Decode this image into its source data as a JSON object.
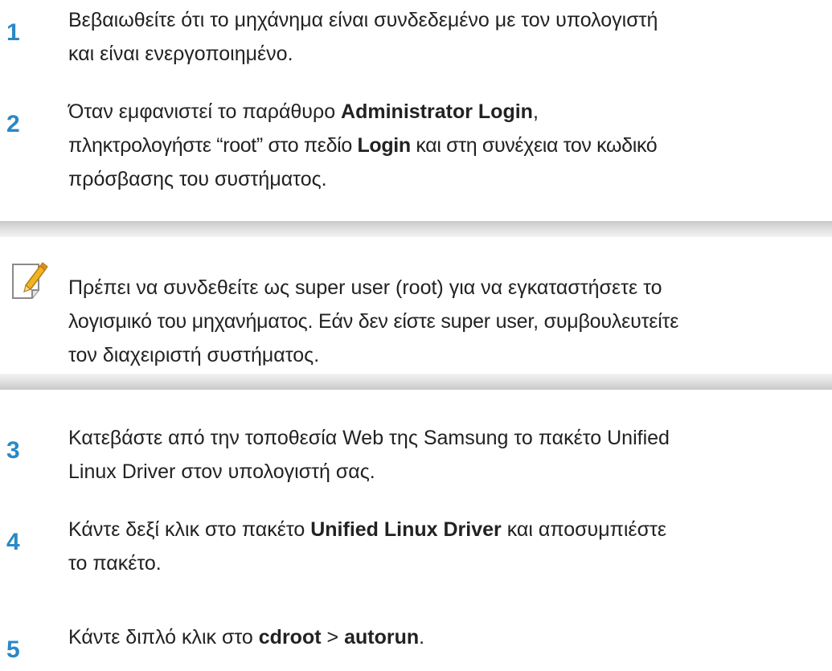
{
  "steps": [
    {
      "number": "1",
      "lines": [
        [
          {
            "t": "Βεβαιωθείτε ότι το μηχάνημα είναι συνδεδεμένο με τον υπολογιστή",
            "b": false
          }
        ],
        [
          {
            "t": "και είναι ενεργοποιημένο.",
            "b": false
          }
        ]
      ]
    },
    {
      "number": "2",
      "lines": [
        [
          {
            "t": "Όταν εμφανιστεί το παράθυρο ",
            "b": false
          },
          {
            "t": "Administrator Login",
            "b": true
          },
          {
            "t": ",",
            "b": false
          }
        ],
        [
          {
            "t": "πληκτρολογήστε “root” στο πεδίο ",
            "b": false
          },
          {
            "t": "Login",
            "b": true
          },
          {
            "t": " και στη συνέχεια τον κωδικό",
            "b": false
          }
        ],
        [
          {
            "t": "πρόσβασης του συστήματος.",
            "b": false
          }
        ]
      ]
    },
    {
      "number": "3",
      "lines": [
        [
          {
            "t": "Κατεβάστε από την τοποθεσία Web της Samsung το πακέτο Unified",
            "b": false
          }
        ],
        [
          {
            "t": "Linux Driver στον υπολογιστή σας.",
            "b": false
          }
        ]
      ]
    },
    {
      "number": "4",
      "lines": [
        [
          {
            "t": "Κάντε δεξί κλικ στο πακέτο ",
            "b": false
          },
          {
            "t": "Unified Linux Driver",
            "b": true
          },
          {
            "t": " και αποσυμπιέστε",
            "b": false
          }
        ],
        [
          {
            "t": "το πακέτο.",
            "b": false
          }
        ]
      ]
    },
    {
      "number": "5",
      "lines": [
        [
          {
            "t": "Κάντε διπλό κλικ στο ",
            "b": false
          },
          {
            "t": "cdroot",
            "b": true
          },
          {
            "t": " > ",
            "b": false
          },
          {
            "t": "autorun",
            "b": true
          },
          {
            "t": ".",
            "b": false
          }
        ]
      ]
    }
  ],
  "note": {
    "icon": "note-pencil-icon",
    "lines": [
      "Πρέπει να συνδεθείτε ως super user (root) για να εγκαταστήσετε το",
      "λογισμικό του μηχανήματος. Εάν δεν είστε super user, συμβουλευτείτε",
      "τον διαχειριστή συστήματος."
    ]
  },
  "colors": {
    "step_number": "#2a88c6",
    "text": "#222222",
    "note_bar": "#d9d9d9"
  }
}
